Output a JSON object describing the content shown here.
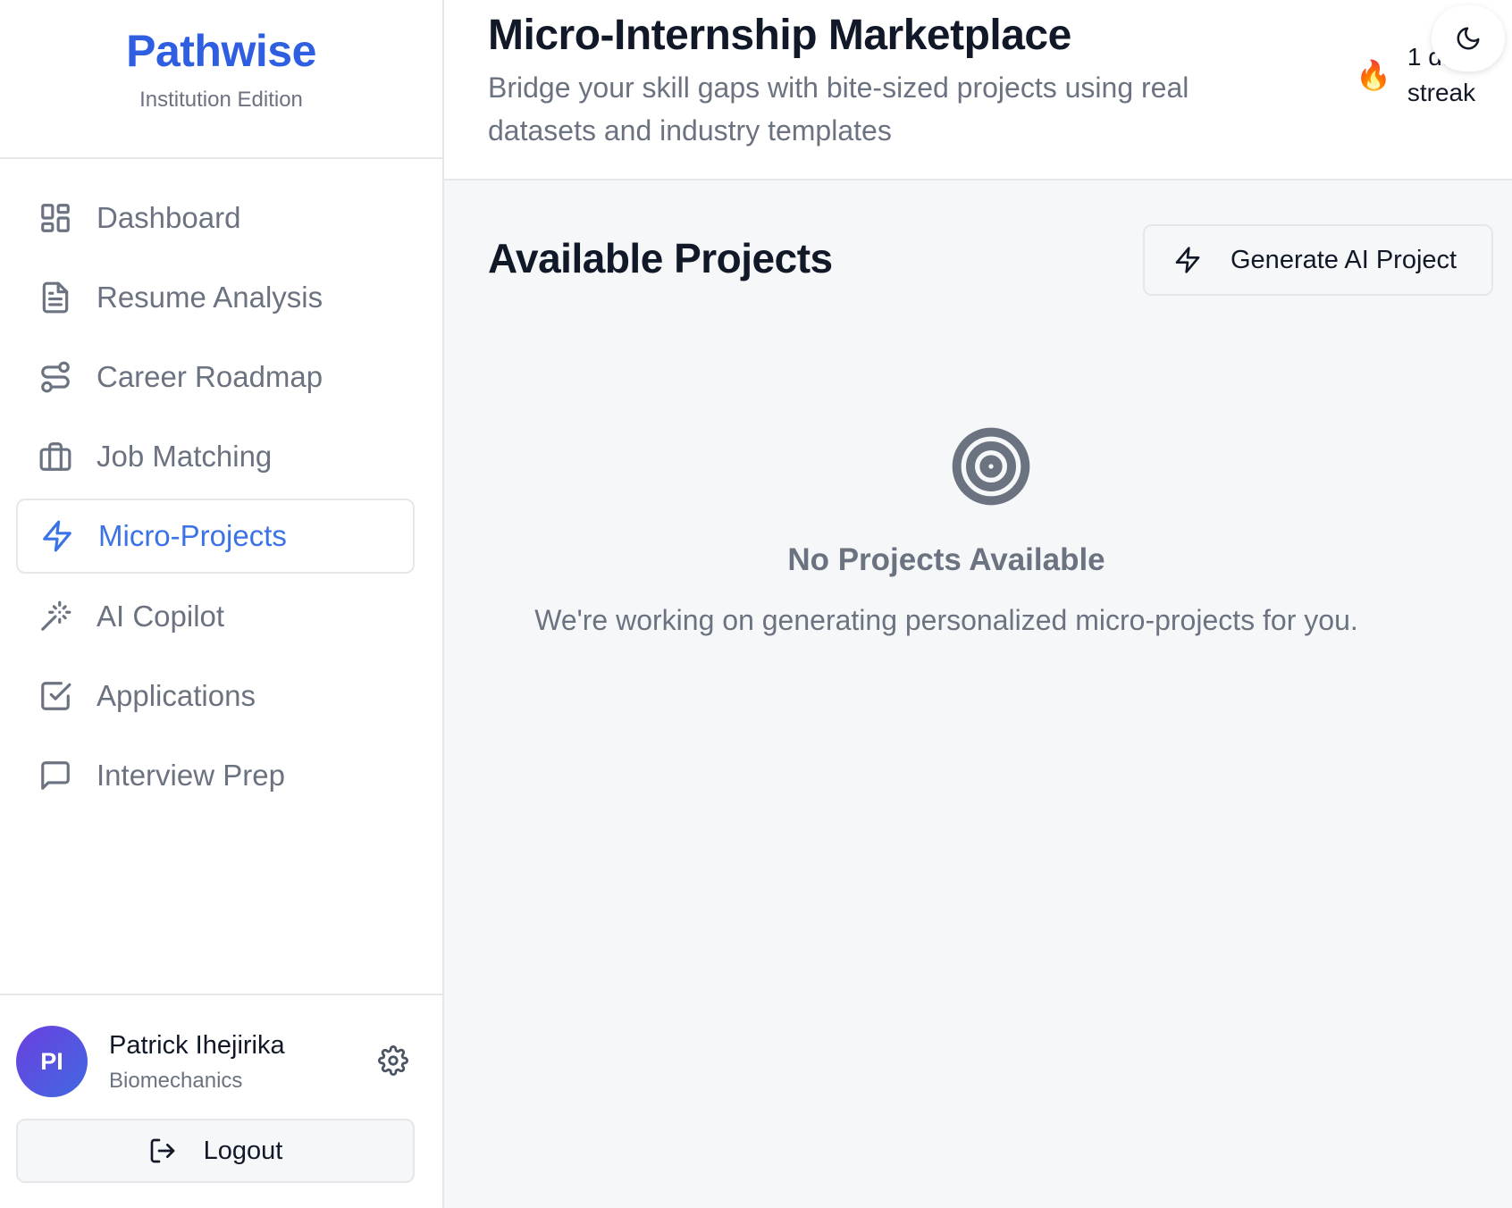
{
  "brand": {
    "name": "Pathwise",
    "edition": "Institution Edition"
  },
  "sidebar": {
    "items": [
      {
        "label": "Dashboard",
        "icon": "dashboard-icon"
      },
      {
        "label": "Resume Analysis",
        "icon": "document-icon"
      },
      {
        "label": "Career Roadmap",
        "icon": "route-icon"
      },
      {
        "label": "Job Matching",
        "icon": "briefcase-icon"
      },
      {
        "label": "Micro-Projects",
        "icon": "lightning-icon",
        "active": true
      },
      {
        "label": "AI Copilot",
        "icon": "magic-wand-icon"
      },
      {
        "label": "Applications",
        "icon": "checkbox-icon"
      },
      {
        "label": "Interview Prep",
        "icon": "chat-bubble-icon"
      }
    ]
  },
  "user": {
    "initials": "PI",
    "name": "Patrick Ihejirika",
    "department": "Biomechanics"
  },
  "logout": {
    "label": "Logout"
  },
  "header": {
    "title": "Micro-Internship Marketplace",
    "subtitle": "Bridge your skill gaps with bite-sized projects using real datasets and industry templates",
    "streak": {
      "icon": "🔥",
      "line1": "1 day",
      "line2": "streak"
    }
  },
  "main": {
    "section_title": "Available Projects",
    "generate_button": "Generate AI Project",
    "empty_title": "No Projects Available",
    "empty_text": "We're working on generating personalized micro-projects for you."
  },
  "colors": {
    "accent": "#3b73e6",
    "brand": "#2f5fe0",
    "muted": "#6b7280"
  }
}
